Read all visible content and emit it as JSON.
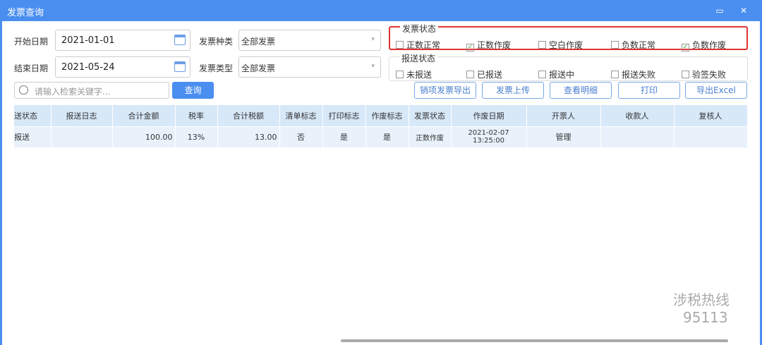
{
  "window": {
    "title": "发票查询",
    "maximize_icon": "maximize-icon",
    "close_icon": "close-icon"
  },
  "filters": {
    "start_label": "开始日期",
    "start_value": "2021-01-01",
    "end_label": "结束日期",
    "end_value": "2021-05-24",
    "kind_label": "发票种类",
    "kind_value": "全部发票",
    "type_label": "发票类型",
    "type_value": "全部发票",
    "search_placeholder": "请输入检索关键字...",
    "query_label": "查询"
  },
  "invoice_status": {
    "title": "发票状态",
    "options": [
      {
        "label": "正数正常",
        "checked": false
      },
      {
        "label": "正数作废",
        "checked": true
      },
      {
        "label": "空白作废",
        "checked": false
      },
      {
        "label": "负数正常",
        "checked": false
      },
      {
        "label": "负数作废",
        "checked": true
      }
    ]
  },
  "report_status": {
    "title": "报送状态",
    "options": [
      {
        "label": "未报送",
        "checked": false
      },
      {
        "label": "已报送",
        "checked": false
      },
      {
        "label": "报送中",
        "checked": false
      },
      {
        "label": "报送失败",
        "checked": false
      },
      {
        "label": "验签失败",
        "checked": false
      }
    ]
  },
  "actions": [
    "销项发票导出",
    "发票上传",
    "查看明细",
    "打印",
    "导出Excel"
  ],
  "table": {
    "columns": [
      "送状态",
      "报送日志",
      "合计金额",
      "税率",
      "合计税额",
      "清单标志",
      "打印标志",
      "作废标志",
      "发票状态",
      "作废日期",
      "开票人",
      "收款人",
      "复核人"
    ],
    "rows": [
      [
        "报送",
        "",
        "100.00",
        "13%",
        "13.00",
        "否",
        "是",
        "是",
        "正数作废",
        "2021-02-07 13:25:00",
        "管理",
        "",
        ""
      ]
    ]
  },
  "watermark": {
    "line1": "涉税热线",
    "line2": "95113"
  }
}
